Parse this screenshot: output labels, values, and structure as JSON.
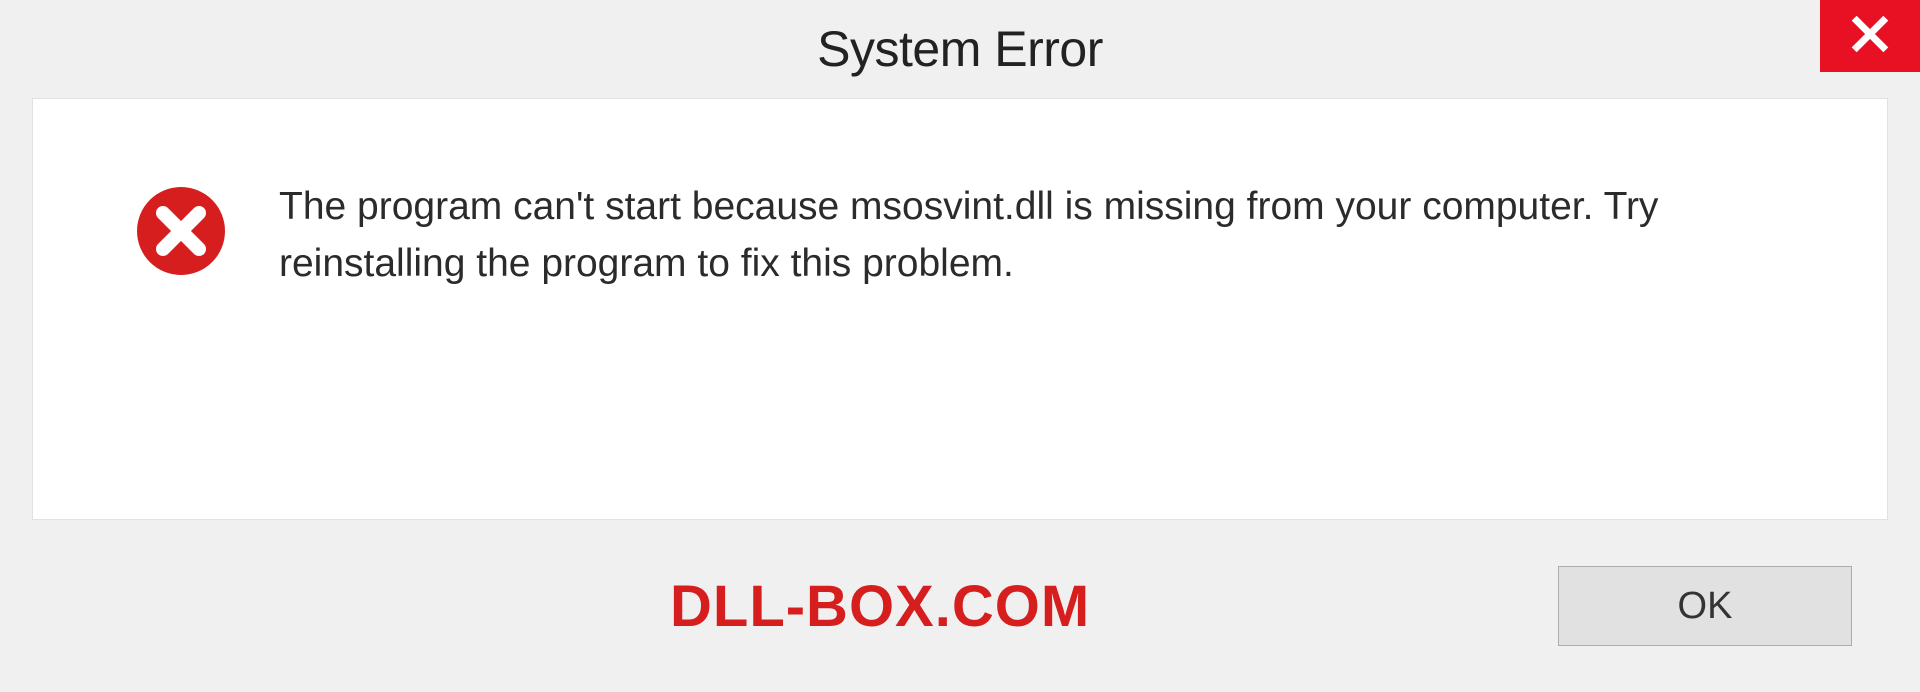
{
  "titlebar": {
    "title": "System Error",
    "close_icon": "close-x"
  },
  "body": {
    "error_icon": "error-circle-x",
    "message": "The program can't start because msosvint.dll is missing from your computer. Try reinstalling the program to fix this problem."
  },
  "footer": {
    "watermark": "DLL-BOX.COM",
    "ok_label": "OK"
  },
  "colors": {
    "close_bg": "#e81123",
    "error_red": "#d61e1e",
    "panel_bg": "#ffffff",
    "dialog_bg": "#f0f0f0"
  }
}
